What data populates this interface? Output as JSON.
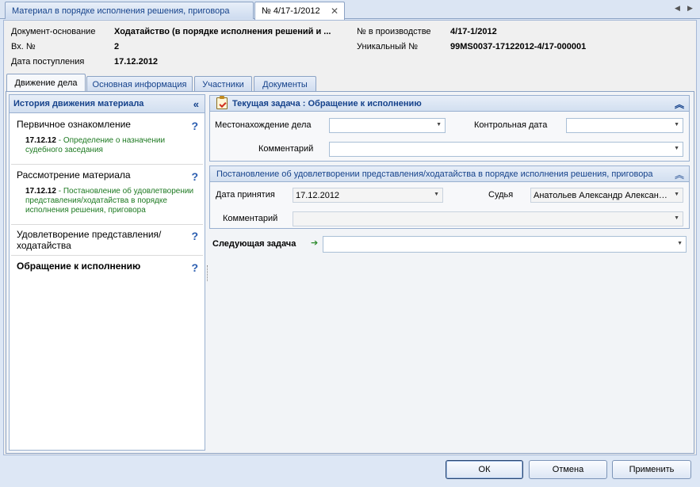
{
  "doc_tabs": [
    {
      "label": "Материал в порядке исполнения решения, приговора"
    },
    {
      "label": "№ 4/17-1/2012"
    }
  ],
  "header": {
    "doc_base_label": "Документ-основание",
    "doc_base_value": "Ходатайство (в порядке исполнения решений и ...",
    "in_no_label": "Вх. №",
    "in_no_value": "2",
    "received_label": "Дата поступления",
    "received_value": "17.12.2012",
    "prod_no_label": "№ в производстве",
    "prod_no_value": "4/17-1/2012",
    "unique_label": "Уникальный №",
    "unique_value": "99MS0037-17122012-4/17-000001"
  },
  "inner_tabs": [
    {
      "label": "Движение дела"
    },
    {
      "label": "Основная информация"
    },
    {
      "label": "Участники"
    },
    {
      "label": "Документы"
    }
  ],
  "history": {
    "title": "История движения материала",
    "items": [
      {
        "title": "Первичное ознакомление",
        "date": "17.12.12",
        "note": "Определение о назначении судебного заседания"
      },
      {
        "title": "Рассмотрение материала",
        "date": "17.12.12",
        "note": "Постановление об удовлетворении представления/ходатайства в порядке исполнения решения, приговора"
      },
      {
        "title": "Удовлетворение представления/ходатайства"
      },
      {
        "title": "Обращение к исполнению"
      }
    ]
  },
  "current_task": {
    "title": "Текущая задача : Обращение к исполнению",
    "location_label": "Местонахождение дела",
    "location_value": "",
    "control_date_label": "Контрольная дата",
    "control_date_value": "",
    "comment_label": "Комментарий",
    "comment_value": ""
  },
  "resolution": {
    "title": "Постановление об удовлетворении представления/ходатайства в порядке исполнения решения, приговора",
    "date_label": "Дата принятия",
    "date_value": "17.12.2012",
    "judge_label": "Судья",
    "judge_value": "Анатольев Александр Александрович",
    "comment_label": "Комментарий",
    "comment_value": ""
  },
  "next_task": {
    "label": "Следующая задача",
    "value": ""
  },
  "buttons": {
    "ok": "ОК",
    "cancel": "Отмена",
    "apply": "Применить"
  },
  "icons": {
    "help": "?",
    "collapse_left": "«",
    "collapse_up": "︽",
    "dropdown": "▼",
    "close": "✕",
    "arrow_right": "➔"
  }
}
